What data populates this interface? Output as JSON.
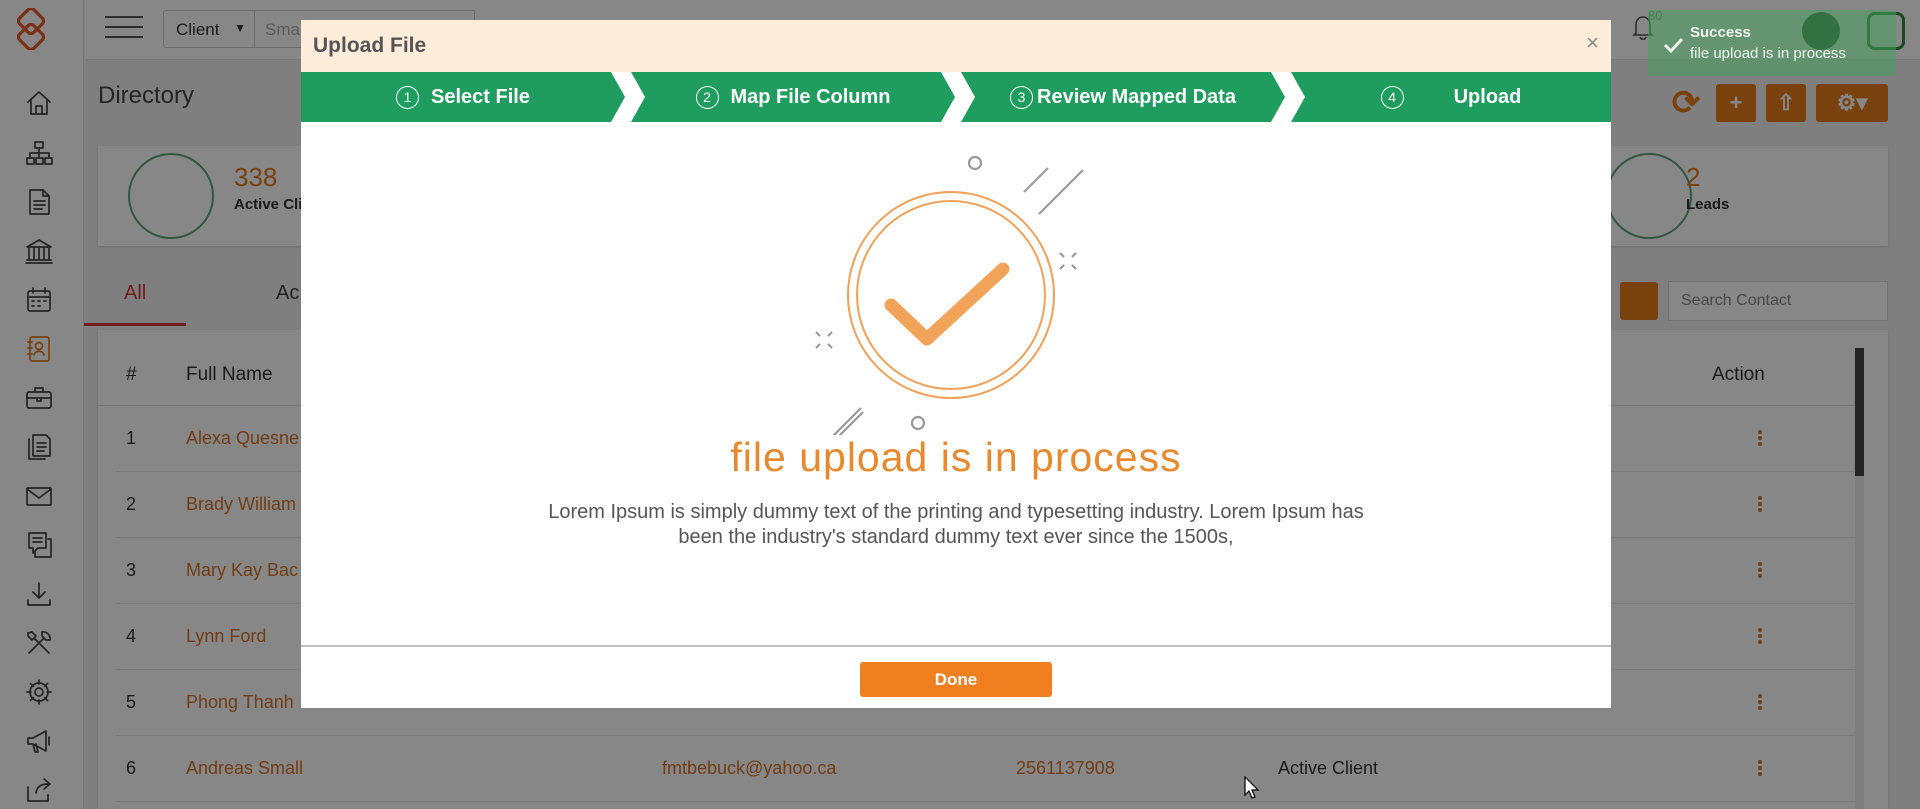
{
  "topbar": {
    "client_select": "Client",
    "search_placeholder": "Sma",
    "notification_count": "80"
  },
  "page": {
    "title": "Directory"
  },
  "stats": [
    {
      "value": "338",
      "label": "Active Cli"
    },
    {
      "value": "2",
      "label": "Leads"
    }
  ],
  "tabs": [
    "All",
    "Ac"
  ],
  "contact_search_placeholder": "Search Contact",
  "table": {
    "headers": {
      "index": "#",
      "full_name": "Full Name",
      "action": "Action"
    },
    "rows": [
      {
        "index": "1",
        "name": "Alexa Quesne",
        "email": "",
        "phone": "",
        "status": ""
      },
      {
        "index": "2",
        "name": "Brady William",
        "email": "",
        "phone": "",
        "status": ""
      },
      {
        "index": "3",
        "name": "Mary Kay Bac",
        "email": "",
        "phone": "",
        "status": ""
      },
      {
        "index": "4",
        "name": "Lynn Ford",
        "email": "",
        "phone": "",
        "status": ""
      },
      {
        "index": "5",
        "name": "Phong Thanh",
        "email": "",
        "phone": "",
        "status": ""
      },
      {
        "index": "6",
        "name": "Andreas Small",
        "email": "fmtbebuck@yahoo.ca",
        "phone": "2561137908",
        "status": "Active Client"
      }
    ]
  },
  "modal": {
    "title": "Upload File",
    "close_symbol": "×",
    "steps": [
      {
        "num": "1",
        "label": "Select File"
      },
      {
        "num": "2",
        "label": "Map File Column"
      },
      {
        "num": "3",
        "label": "Review Mapped Data"
      },
      {
        "num": "4",
        "label": "Upload"
      }
    ],
    "heading": "file upload is in process",
    "body": "Lorem Ipsum is simply dummy text of the printing and typesetting industry. Lorem Ipsum has been the industry's standard dummy text ever since the 1500s,",
    "done_label": "Done"
  },
  "toast": {
    "title": "Success",
    "message": "file upload is in process"
  },
  "colors": {
    "accent": "#e37b1c",
    "step_green": "#1f9d5e",
    "modal_header": "#fdecd9",
    "heading_orange": "#e8892e"
  }
}
